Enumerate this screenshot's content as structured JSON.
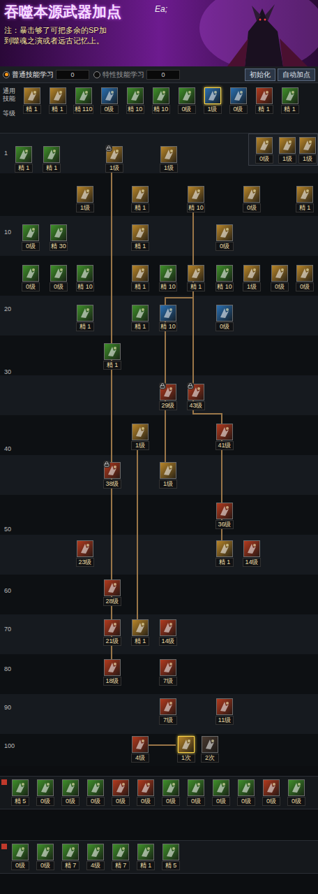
{
  "banner": {
    "title": "吞噬本源武器加点",
    "note": [
      "注：暴击够了可把多余的SP加",
      "到噬魂之演或者远古记忆上。"
    ],
    "signature": "Ea;"
  },
  "tabs": [
    {
      "label": "普通技能学习",
      "count": "0",
      "selected": true
    },
    {
      "label": "特性技能学习",
      "count": "0",
      "selected": false
    }
  ],
  "buttons": [
    "初始化",
    "自动加点"
  ],
  "common": {
    "label": "通用技能",
    "level_label": "等级",
    "skills": [
      {
        "label": "精 1",
        "color": "#b8862a",
        "selected": false
      },
      {
        "label": "精 1",
        "color": "#b8862a",
        "selected": false
      },
      {
        "label": "精 110",
        "color": "#3f8f2a",
        "selected": false
      },
      {
        "label": "0级",
        "color": "#2a6fb0",
        "selected": false
      },
      {
        "label": "精 10",
        "color": "#3f8f2a",
        "selected": false
      },
      {
        "label": "精 10",
        "color": "#3f8f2a",
        "selected": false
      },
      {
        "label": "0级",
        "color": "#3f8f2a",
        "selected": false
      },
      {
        "label": "1级",
        "color": "#2a6fb0",
        "selected": true
      },
      {
        "label": "0级",
        "color": "#2a6fb0",
        "selected": false
      },
      {
        "label": "精 1",
        "color": "#b23a1e",
        "selected": false
      },
      {
        "label": "精 1",
        "color": "#3f8f2a",
        "selected": false
      }
    ]
  },
  "levels": [
    "1",
    "10",
    "20",
    "30",
    "40",
    "50",
    "60",
    "70",
    "80",
    "90",
    "100"
  ],
  "tree": [
    {
      "label": "精 1",
      "color": "#3f8f2a",
      "locked": false,
      "selected": false
    },
    {
      "label": "精 1",
      "color": "#3f8f2a",
      "locked": false,
      "selected": false
    },
    {
      "label": "1级",
      "color": "#b8862a",
      "locked": true,
      "selected": false
    },
    {
      "label": "1级",
      "color": "#b8862a",
      "locked": false,
      "selected": false
    },
    {
      "label": "0级",
      "color": "#b8862a",
      "locked": false,
      "selected": false
    },
    {
      "label": "1级",
      "color": "#b8862a",
      "locked": false,
      "selected": false
    },
    {
      "label": "1级",
      "color": "#b8862a",
      "locked": false,
      "selected": false
    },
    {
      "label": "1级",
      "color": "#b8862a",
      "locked": false,
      "selected": false
    },
    {
      "label": "精 1",
      "color": "#b8862a",
      "locked": false,
      "selected": false
    },
    {
      "label": "精 10",
      "color": "#b8862a",
      "locked": false,
      "selected": false
    },
    {
      "label": "0级",
      "color": "#b8862a",
      "locked": false,
      "selected": false
    },
    {
      "label": "精 1",
      "color": "#b8862a",
      "locked": false,
      "selected": false
    },
    {
      "label": "0级",
      "color": "#3f8f2a",
      "locked": false,
      "selected": false
    },
    {
      "label": "精 30",
      "color": "#3f8f2a",
      "locked": false,
      "selected": false
    },
    {
      "label": "精 1",
      "color": "#b8862a",
      "locked": false,
      "selected": false
    },
    {
      "label": "0级",
      "color": "#b8862a",
      "locked": false,
      "selected": false
    },
    {
      "label": "0级",
      "color": "#3f8f2a",
      "locked": false,
      "selected": false
    },
    {
      "label": "0级",
      "color": "#3f8f2a",
      "locked": false,
      "selected": false
    },
    {
      "label": "精 10",
      "color": "#3f8f2a",
      "locked": false,
      "selected": false
    },
    {
      "label": "精 1",
      "color": "#b8862a",
      "locked": false,
      "selected": false
    },
    {
      "label": "精 10",
      "color": "#3f8f2a",
      "locked": false,
      "selected": false
    },
    {
      "label": "精 1",
      "color": "#b8862a",
      "locked": false,
      "selected": false
    },
    {
      "label": "精 10",
      "color": "#3f8f2a",
      "locked": false,
      "selected": false
    },
    {
      "label": "1级",
      "color": "#b8862a",
      "locked": false,
      "selected": false
    },
    {
      "label": "0级",
      "color": "#b8862a",
      "locked": false,
      "selected": false
    },
    {
      "label": "0级",
      "color": "#b8862a",
      "locked": false,
      "selected": false
    },
    {
      "label": "精 1",
      "color": "#3f8f2a",
      "locked": false,
      "selected": false
    },
    {
      "label": "精 1",
      "color": "#3f8f2a",
      "locked": false,
      "selected": false
    },
    {
      "label": "精 10",
      "color": "#2a6fb0",
      "locked": false,
      "selected": false
    },
    {
      "label": "0级",
      "color": "#2a6fb0",
      "locked": false,
      "selected": false
    },
    {
      "label": "精 1",
      "color": "#3f8f2a",
      "locked": false,
      "selected": false
    },
    {
      "label": "29级",
      "color": "#b23a1e",
      "locked": true,
      "selected": false
    },
    {
      "label": "43级",
      "color": "#b23a1e",
      "locked": true,
      "selected": false
    },
    {
      "label": "1级",
      "color": "#b8862a",
      "locked": false,
      "selected": false
    },
    {
      "label": "41级",
      "color": "#b23a1e",
      "locked": false,
      "selected": false
    },
    {
      "label": "38级",
      "color": "#b23a1e",
      "locked": true,
      "selected": false
    },
    {
      "label": "1级",
      "color": "#b8862a",
      "locked": false,
      "selected": false
    },
    {
      "label": "36级",
      "color": "#b23a1e",
      "locked": false,
      "selected": false
    },
    {
      "label": "23级",
      "color": "#b23a1e",
      "locked": false,
      "selected": false
    },
    {
      "label": "精 1",
      "color": "#b8862a",
      "locked": false,
      "selected": false
    },
    {
      "label": "14级",
      "color": "#b23a1e",
      "locked": false,
      "selected": false
    },
    {
      "label": "28级",
      "color": "#b23a1e",
      "locked": false,
      "selected": false
    },
    {
      "label": "21级",
      "color": "#b23a1e",
      "locked": false,
      "selected": false
    },
    {
      "label": "精 1",
      "color": "#b8862a",
      "locked": false,
      "selected": false
    },
    {
      "label": "14级",
      "color": "#b23a1e",
      "locked": false,
      "selected": false
    },
    {
      "label": "18级",
      "color": "#b23a1e",
      "locked": false,
      "selected": false
    },
    {
      "label": "7级",
      "color": "#b23a1e",
      "locked": false,
      "selected": false
    },
    {
      "label": "7级",
      "color": "#b23a1e",
      "locked": false,
      "selected": false
    },
    {
      "label": "11级",
      "color": "#b23a1e",
      "locked": false,
      "selected": false
    },
    {
      "label": "4级",
      "color": "#b23a1e",
      "locked": false,
      "selected": false
    },
    {
      "label": "1次",
      "color": "#b8862a",
      "locked": false,
      "selected": true
    },
    {
      "label": "2次",
      "color": "#4a3a30",
      "locked": false,
      "selected": false
    }
  ],
  "bars": [
    [
      {
        "label": "精 5",
        "color": "#3f8f2a"
      },
      {
        "label": "0级",
        "color": "#3f8f2a"
      },
      {
        "label": "0级",
        "color": "#3f8f2a"
      },
      {
        "label": "0级",
        "color": "#3f8f2a"
      },
      {
        "label": "0级",
        "color": "#b23a1e"
      },
      {
        "label": "0级",
        "color": "#b23a1e"
      },
      {
        "label": "0级",
        "color": "#3f8f2a"
      },
      {
        "label": "0级",
        "color": "#3f8f2a"
      },
      {
        "label": "0级",
        "color": "#3f8f2a"
      },
      {
        "label": "0级",
        "color": "#3f8f2a"
      },
      {
        "label": "0级",
        "color": "#b23a1e"
      },
      {
        "label": "0级",
        "color": "#3f8f2a"
      }
    ],
    [
      {
        "label": "0级",
        "color": "#3f8f2a"
      },
      {
        "label": "0级",
        "color": "#3f8f2a"
      },
      {
        "label": "精 7",
        "color": "#3f8f2a"
      },
      {
        "label": "4级",
        "color": "#3f8f2a"
      },
      {
        "label": "精 7",
        "color": "#3f8f2a"
      },
      {
        "label": "精 1",
        "color": "#3f8f2a"
      },
      {
        "label": "精 5",
        "color": "#3f8f2a"
      }
    ]
  ]
}
